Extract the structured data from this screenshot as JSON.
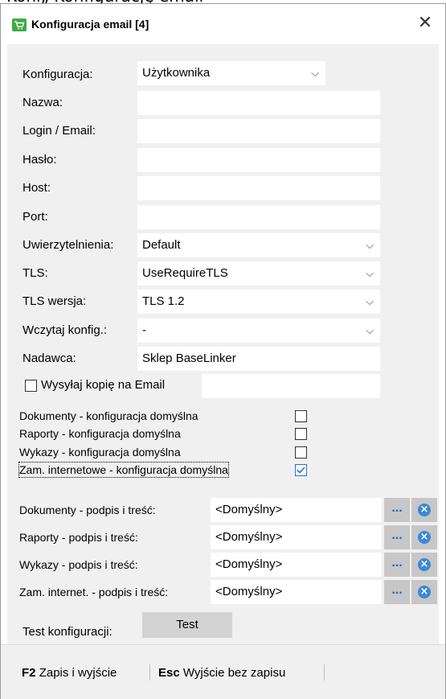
{
  "window": {
    "title": "Konfiguracja email [4]"
  },
  "form": {
    "konfiguracja": {
      "label": "Konfiguracja:",
      "value": "Użytkownika"
    },
    "nazwa": {
      "label": "Nazwa:",
      "value": ""
    },
    "login": {
      "label": "Login / Email:",
      "value": ""
    },
    "haslo": {
      "label": "Hasło:",
      "value": ""
    },
    "host": {
      "label": "Host:",
      "value": ""
    },
    "port": {
      "label": "Port:",
      "value": ""
    },
    "uwierzytelnienia": {
      "label": "Uwierzytelnienia:",
      "value": "Default"
    },
    "tls": {
      "label": "TLS:",
      "value": "UseRequireTLS"
    },
    "tls_wersja": {
      "label": "TLS wersja:",
      "value": "TLS 1.2"
    },
    "wczytaj": {
      "label": "Wczytaj konfig.:",
      "value": "-"
    },
    "nadawca": {
      "label": "Nadawca:",
      "value": "Sklep BaseLinker"
    },
    "kopia": {
      "label": "Wysyłaj kopię na Email",
      "checked": false,
      "value": ""
    }
  },
  "defaults": [
    {
      "label": "Dokumenty - konfiguracja domyślna",
      "checked": false
    },
    {
      "label": "Raporty - konfiguracja domyślna",
      "checked": false
    },
    {
      "label": "Wykazy - konfiguracja domyślna",
      "checked": false
    },
    {
      "label": "Zam. internetowe - konfiguracja domyślna",
      "checked": true
    }
  ],
  "signatures": [
    {
      "label": "Dokumenty - podpis i treść:",
      "value": "<Domyślny>"
    },
    {
      "label": "Raporty - podpis i treść:",
      "value": "<Domyślny>"
    },
    {
      "label": "Wykazy - podpis i treść:",
      "value": "<Domyślny>"
    },
    {
      "label": "Zam. internet. - podpis i treść:",
      "value": "<Domyślny>"
    }
  ],
  "buttons": {
    "dots": "...",
    "test_label": "Test konfiguracji:",
    "test": "Test"
  },
  "footer": {
    "f2_key": "F2",
    "f2_label": "Zapis i wyjście",
    "esc_key": "Esc",
    "esc_label": "Wyjście bez zapisu"
  },
  "top_partial_text": "...",
  "icons": {
    "app": "cart-icon",
    "close": "close-icon",
    "clear": "clear-icon",
    "chevron": "chevron-down-icon"
  }
}
